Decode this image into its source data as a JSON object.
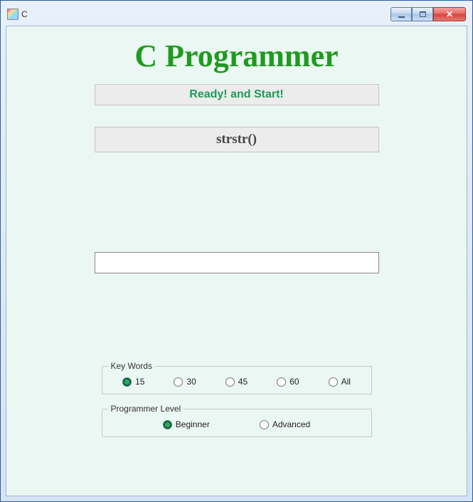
{
  "titlebar": {
    "title": " C"
  },
  "heading": "C Programmer",
  "statusBar": "Ready! and Start!",
  "keywordBar": "strstr()",
  "input": {
    "value": ""
  },
  "groupKeywords": {
    "legend": "Key Words",
    "options": [
      {
        "label": "15",
        "checked": true
      },
      {
        "label": "30",
        "checked": false
      },
      {
        "label": "45",
        "checked": false
      },
      {
        "label": "60",
        "checked": false
      },
      {
        "label": "All",
        "checked": false
      }
    ]
  },
  "groupLevel": {
    "legend": "Programmer Level",
    "options": [
      {
        "label": "Beginner",
        "checked": true
      },
      {
        "label": "Advanced",
        "checked": false
      }
    ]
  }
}
